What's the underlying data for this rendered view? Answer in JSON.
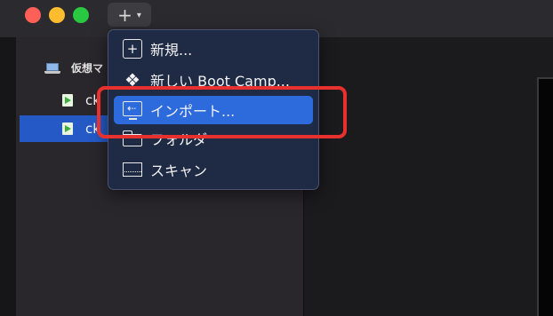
{
  "toolbar": {
    "add_symbol": "+",
    "chevron": "⌄"
  },
  "sidebar": {
    "section_title": "仮想マ",
    "items": [
      {
        "label": "ck",
        "icon": "vm-play-icon",
        "selected": false
      },
      {
        "label": "ck",
        "icon": "vm-play-icon",
        "selected": true
      }
    ]
  },
  "menu": {
    "items": [
      {
        "label": "新規...",
        "icon": "plus-square-icon"
      },
      {
        "label": "新しい Boot Camp...",
        "icon": "bootcamp-diamond-icon"
      },
      {
        "label": "インポート...",
        "icon": "import-icon",
        "highlighted": true
      },
      {
        "label": "フォルダ",
        "icon": "folder-icon"
      },
      {
        "label": "スキャン",
        "icon": "scan-icon"
      }
    ],
    "highlight_color": "#2d6bdd"
  },
  "annotation": {
    "color": "#e8302f",
    "target": "menu-item-import"
  }
}
